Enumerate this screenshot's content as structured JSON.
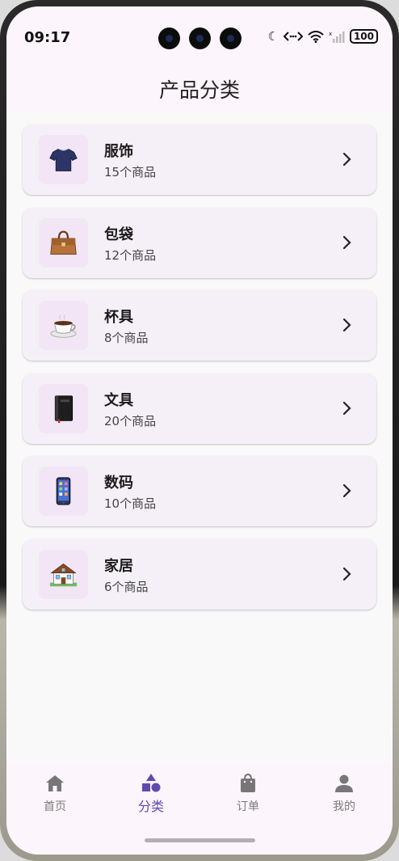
{
  "status_bar": {
    "time": "09:17",
    "battery": "100"
  },
  "header": {
    "title": "产品分类"
  },
  "categories": [
    {
      "name": "服饰",
      "count": "15个商品",
      "icon": "tshirt-icon"
    },
    {
      "name": "包袋",
      "count": "12个商品",
      "icon": "handbag-icon"
    },
    {
      "name": "杯具",
      "count": "8个商品",
      "icon": "coffee-cup-icon"
    },
    {
      "name": "文具",
      "count": "20个商品",
      "icon": "notebook-icon"
    },
    {
      "name": "数码",
      "count": "10个商品",
      "icon": "mobile-phone-icon"
    },
    {
      "name": "家居",
      "count": "6个商品",
      "icon": "house-icon"
    }
  ],
  "tabs": [
    {
      "label": "首页",
      "icon": "home-icon",
      "active": false
    },
    {
      "label": "分类",
      "icon": "shapes-icon",
      "active": true
    },
    {
      "label": "订单",
      "icon": "shopping-bag-icon",
      "active": false
    },
    {
      "label": "我的",
      "icon": "person-icon",
      "active": false
    }
  ],
  "colors": {
    "accent": "#5e4bb0",
    "card_background": "#f5f0f7",
    "thumb_background": "#f2e6f6",
    "header_background": "#fcf5fb"
  }
}
